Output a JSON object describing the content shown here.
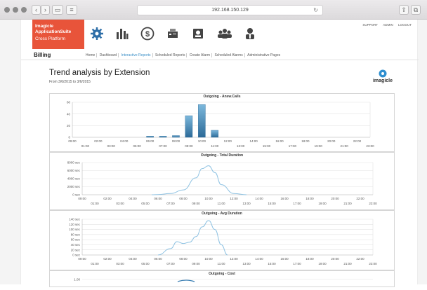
{
  "browser": {
    "url": "192.168.150.129"
  },
  "brand": {
    "line1": "Imagicle",
    "line2": "ApplicationSuite",
    "line3": "Cross Platform"
  },
  "nav_icons": [
    "gear-icon",
    "bar-chart-icon",
    "dollar-icon",
    "fax-icon",
    "contact-card-icon",
    "group-icon",
    "user-icon"
  ],
  "top_links": [
    "SUPPORT",
    "ADMIN",
    "LOGOUT"
  ],
  "section": "Billing",
  "menu": [
    "Home",
    "Dashboard",
    "Interactive Reports",
    "Scheduled Reports",
    "Create Alarm",
    "Scheduled Alarms",
    "Administrative Pages"
  ],
  "active_menu": "Interactive Reports",
  "page_title": "Trend analysis by Extension",
  "date_range": "From 3/6/2015 to 3/6/2015",
  "logo_text": "imagicle",
  "colors": {
    "brand": "#e8543a",
    "accent": "#3a8fc7",
    "series": "#3b7fb3"
  },
  "hours_top": [
    "09:00",
    "02:00",
    "04:00",
    "06:00",
    "08:00",
    "10:00",
    "12:00",
    "14:00",
    "16:00",
    "18:00",
    "20:00",
    "22:00"
  ],
  "hours_bottom": [
    "01:00",
    "03:00",
    "05:00",
    "07:00",
    "09:00",
    "11:00",
    "13:00",
    "15:00",
    "17:00",
    "19:00",
    "21:00",
    "23:00"
  ],
  "chart_data": [
    {
      "type": "bar",
      "title": "Outgoing - Answ.Calls",
      "x": [
        "00:00",
        "01:00",
        "02:00",
        "03:00",
        "04:00",
        "05:00",
        "06:00",
        "07:00",
        "08:00",
        "09:00",
        "10:00",
        "11:00",
        "12:00",
        "13:00",
        "14:00",
        "15:00",
        "16:00",
        "17:00",
        "18:00",
        "19:00",
        "20:00",
        "21:00",
        "22:00",
        "23:00"
      ],
      "values": [
        0,
        0,
        0,
        0,
        0,
        0,
        2,
        2,
        3,
        37,
        56,
        12,
        0,
        0,
        0,
        0,
        0,
        0,
        0,
        0,
        0,
        0,
        0,
        0
      ],
      "yticks": [
        "60",
        "40",
        "20",
        "0"
      ],
      "ylim": [
        0,
        60
      ],
      "grid": true
    },
    {
      "type": "area",
      "title": "Outgoing - Total Duration",
      "x": [
        "05:30",
        "06:00",
        "07:00",
        "08:00",
        "09:00",
        "09:30",
        "10:00",
        "10:30",
        "11:00",
        "12:00",
        "13:00"
      ],
      "values": [
        0,
        50,
        300,
        1200,
        4200,
        6500,
        7200,
        5500,
        2500,
        300,
        0
      ],
      "yticks": [
        "8000 sec",
        "6000 sec",
        "4000 sec",
        "2000 sec",
        "0 sec"
      ],
      "ylim": [
        0,
        8000
      ],
      "grid": true
    },
    {
      "type": "line",
      "title": "Outgoing - Avg Duration",
      "x": [
        "06:00",
        "07:00",
        "07:30",
        "08:00",
        "08:30",
        "09:00",
        "09:30",
        "10:00",
        "10:30",
        "11:00",
        "11:30"
      ],
      "values": [
        0,
        25,
        52,
        45,
        50,
        72,
        110,
        135,
        100,
        40,
        0
      ],
      "yticks": [
        "140 sec",
        "120 sec",
        "100 sec",
        "80 sec",
        "60 sec",
        "40 sec",
        "20 sec",
        "0 sec"
      ],
      "ylim": [
        0,
        140
      ],
      "grid": true
    },
    {
      "type": "line",
      "title": "Outgoing - Cost",
      "x": [
        "06:00"
      ],
      "values": [
        1.0
      ],
      "yticks": [
        "1.00"
      ],
      "ylim": [
        0,
        1
      ],
      "grid": true
    }
  ]
}
